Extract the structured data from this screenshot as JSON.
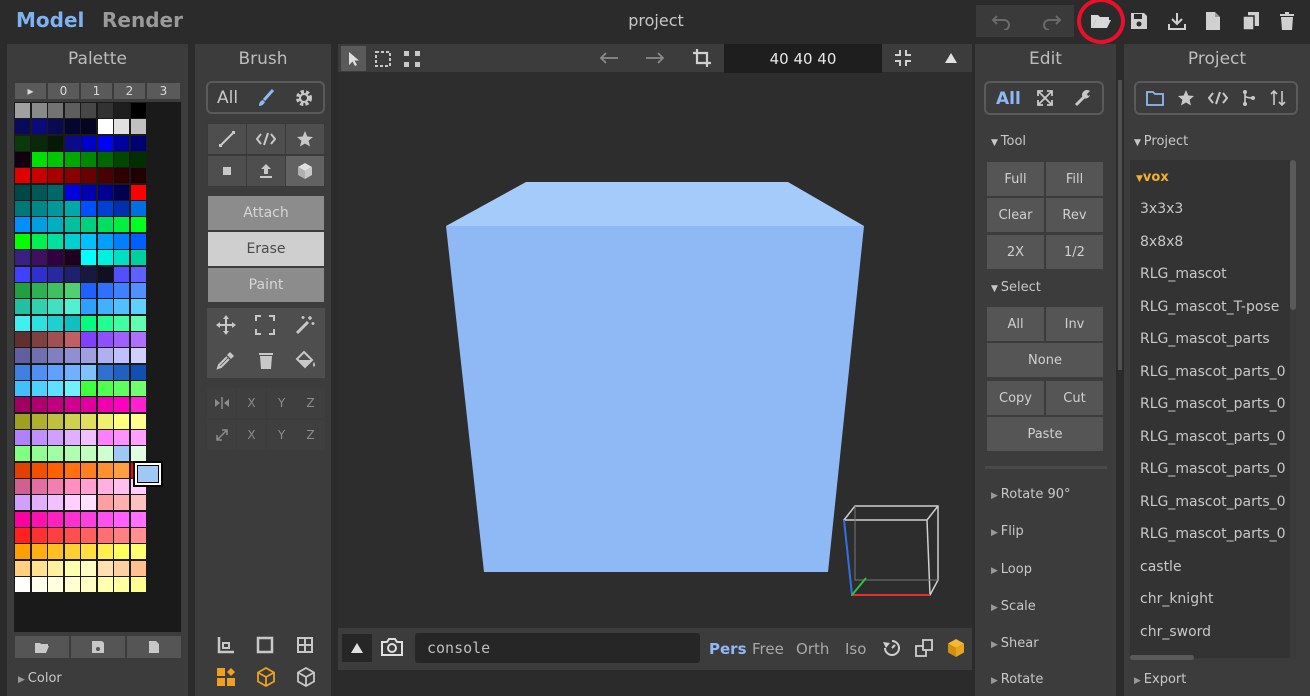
{
  "topbar": {
    "mode_model": "Model",
    "mode_render": "Render",
    "title": "project",
    "icons": [
      "undo-icon",
      "redo-icon",
      "open-folder-icon",
      "save-icon",
      "download-icon",
      "new-file-icon",
      "copy-icon",
      "trash-icon"
    ]
  },
  "palette": {
    "title": "Palette",
    "tabs": [
      "▸",
      "0",
      "1",
      "2",
      "3"
    ],
    "footer_label": "Color",
    "selected_color": "#9ec8f5",
    "rows": [
      [
        "#a0a0a0",
        "#8a8a8a",
        "#737373",
        "#5e5e5e",
        "#474747",
        "#323232",
        "#1e1e1e",
        "#000000"
      ],
      [
        "#0a0a5a",
        "#0a0a7a",
        "#0a0a50",
        "#050530",
        "#050520",
        "#ffffff",
        "#e0e0e0",
        "#c0c0c0"
      ],
      [
        "#0a3a0a",
        "#0a280a",
        "#061806",
        "#0a0a8a",
        "#0000c8",
        "#0000ff",
        "#0000a0",
        "#000070"
      ],
      [
        "#100010",
        "#00e000",
        "#00c800",
        "#00a800",
        "#008800",
        "#006800",
        "#004800",
        "#003000"
      ],
      [
        "#e00000",
        "#c80000",
        "#a80000",
        "#880000",
        "#680000",
        "#480000",
        "#300000",
        "#200000"
      ],
      [
        "#004848",
        "#005858",
        "#006868",
        "#0000e0",
        "#0000b0",
        "#000090",
        "#000050",
        "#ff0000"
      ],
      [
        "#007878",
        "#008888",
        "#009898",
        "#00a8a8",
        "#0050ff",
        "#0040d0",
        "#0030b0",
        "#0070e0"
      ],
      [
        "#0090ff",
        "#00a0e0",
        "#00b0c0",
        "#00c0a0",
        "#00d080",
        "#00e060",
        "#00f040",
        "#00ff20"
      ],
      [
        "#00ff00",
        "#00f050",
        "#00e0a0",
        "#00d0d0",
        "#00c0ff",
        "#00a0ff",
        "#0080ff",
        "#0060ff"
      ],
      [
        "#3a2080",
        "#401060",
        "#300040",
        "#200020",
        "#00ffff",
        "#00f0e0",
        "#00e0c0",
        "#00d0a0"
      ],
      [
        "#4040ff",
        "#3030d0",
        "#2828a0",
        "#202070",
        "#181840",
        "#101020",
        "#5050ff",
        "#6060ff"
      ],
      [
        "#20a040",
        "#30b050",
        "#40c060",
        "#50d070",
        "#2060ff",
        "#3070ff",
        "#4080ff",
        "#5090ff"
      ],
      [
        "#20c0a0",
        "#30d0b0",
        "#40e0c0",
        "#50f0d0",
        "#30a0ff",
        "#40b0ff",
        "#50c0ff",
        "#60d0ff"
      ],
      [
        "#40f0f0",
        "#30e0e0",
        "#20d0d0",
        "#10c0c0",
        "#00ff80",
        "#20ff90",
        "#40ffa0",
        "#60ffb0"
      ],
      [
        "#603030",
        "#804040",
        "#a05050",
        "#c06060",
        "#8040ff",
        "#9050ff",
        "#a060ff",
        "#b070ff"
      ],
      [
        "#6060a0",
        "#7070b0",
        "#8080c0",
        "#9090d0",
        "#a0a0e0",
        "#b0b0f0",
        "#c0c0ff",
        "#d0d0ff"
      ],
      [
        "#4080e0",
        "#5090f0",
        "#60a0ff",
        "#70b0ff",
        "#80c0ff",
        "#3070d0",
        "#2060c0",
        "#1050b0"
      ],
      [
        "#40c0ff",
        "#50d0ff",
        "#60e0ff",
        "#70f0ff",
        "#40ff40",
        "#50ff50",
        "#60ff60",
        "#70ff70"
      ],
      [
        "#a00060",
        "#b00070",
        "#c00080",
        "#d00090",
        "#e000a0",
        "#f000b0",
        "#ff00c0",
        "#ff20d0"
      ],
      [
        "#a0a020",
        "#b0b030",
        "#c0c040",
        "#d0d050",
        "#e0e060",
        "#f0f070",
        "#ffff80",
        "#ffff90"
      ],
      [
        "#b080ff",
        "#c090ff",
        "#d0a0ff",
        "#e0b0ff",
        "#f0c0ff",
        "#ff80ff",
        "#ff90ff",
        "#ffa0ff"
      ],
      [
        "#80ff80",
        "#90ff90",
        "#a0ffa0",
        "#b0ffb0",
        "#c0ffc0",
        "#d0ffd0",
        "#9ec8f5",
        "#e0ffe0"
      ],
      [
        "#e04000",
        "#f05000",
        "#ff6000",
        "#ff7010",
        "#ff8020",
        "#ff9030",
        "#ffa040",
        "#ff0000"
      ],
      [
        "#d06090",
        "#e070a0",
        "#f080b0",
        "#ff90c0",
        "#ffa0d0",
        "#ffb0e0",
        "#ffc0f0",
        "#ffd0ff"
      ],
      [
        "#d0a0ff",
        "#e0b0ff",
        "#f0c0ff",
        "#ffd0ff",
        "#ffe0ff",
        "#ffa0a0",
        "#ffb0b0",
        "#ffc0c0"
      ],
      [
        "#ff00a0",
        "#ff10b0",
        "#ff20c0",
        "#ff30d0",
        "#ff40e0",
        "#ff50f0",
        "#ff60ff",
        "#ff70ff"
      ],
      [
        "#ff2020",
        "#ff3030",
        "#ff4040",
        "#ff5050",
        "#ff6060",
        "#ff7070",
        "#ff8080",
        "#ff9090"
      ],
      [
        "#ffa000",
        "#ffb010",
        "#ffc020",
        "#ffd030",
        "#ffe040",
        "#fff050",
        "#ffff60",
        "#ffff70"
      ],
      [
        "#ffd080",
        "#ffe090",
        "#fff0a0",
        "#ffffb0",
        "#ffffc0",
        "#ffe0b0",
        "#ffd0a0",
        "#ffc090"
      ],
      [
        "#ffffff",
        "#fffff0",
        "#ffffe0",
        "#ffffd0",
        "#ffffc0",
        "#ffffb0",
        "#ffffa0",
        "#ffff90"
      ]
    ]
  },
  "brush": {
    "title": "Brush",
    "filter_all": "All",
    "modes": [
      "Attach",
      "Erase",
      "Paint"
    ],
    "mirror_axes": [
      "X",
      "Y",
      "Z"
    ],
    "scale_axes": [
      "X",
      "Y",
      "Z"
    ]
  },
  "viewport": {
    "size_readout": "40  40  40",
    "console_placeholder": "console",
    "views": [
      "Pers",
      "Free",
      "Orth",
      "Iso"
    ],
    "cube_color": "#8fb9f5"
  },
  "edit": {
    "title": "Edit",
    "filter_all": "All",
    "tool_section": "Tool",
    "tool_buttons": [
      "Full",
      "Fill",
      "Clear",
      "Rev",
      "2X",
      "1/2"
    ],
    "select_section": "Select",
    "select_all": "All",
    "select_inv": "Inv",
    "select_none": "None",
    "select_copy": "Copy",
    "select_cut": "Cut",
    "select_paste": "Paste",
    "collapsed": [
      "Rotate 90°",
      "Flip",
      "Loop",
      "Scale",
      "Shear",
      "Rotate"
    ]
  },
  "project": {
    "title": "Project",
    "section": "Project",
    "folder": "vox",
    "items": [
      "3x3x3",
      "8x8x8",
      "RLG_mascot",
      "RLG_mascot_T-pose",
      "RLG_mascot_parts",
      "RLG_mascot_parts_0",
      "RLG_mascot_parts_0",
      "RLG_mascot_parts_0",
      "RLG_mascot_parts_0",
      "RLG_mascot_parts_0",
      "RLG_mascot_parts_0",
      "castle",
      "chr_knight",
      "chr_sword"
    ],
    "export_label": "Export"
  }
}
